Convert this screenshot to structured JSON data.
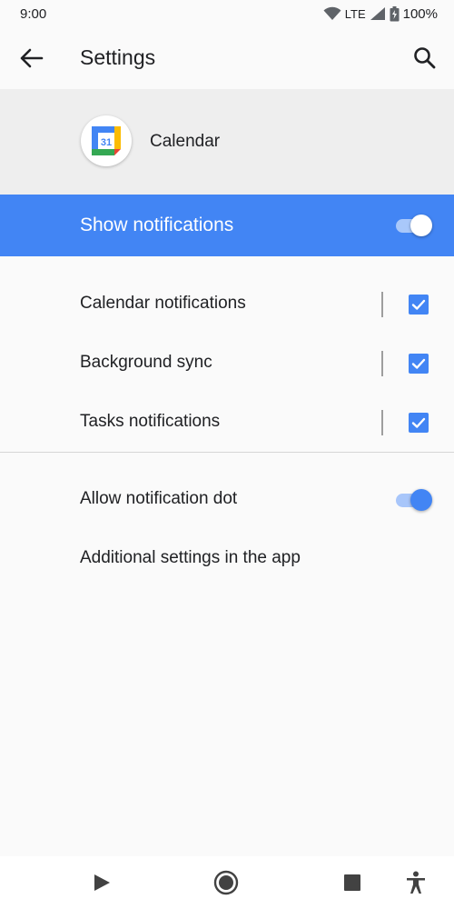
{
  "status_bar": {
    "time": "9:00",
    "network": "LTE",
    "battery": "100%",
    "icons": [
      "wifi-icon",
      "signal-icon",
      "battery-icon"
    ]
  },
  "app_bar": {
    "title": "Settings",
    "back_icon": "arrow-back-icon",
    "search_icon": "search-icon"
  },
  "app_header": {
    "app_name": "Calendar",
    "icon_day": "31"
  },
  "master_switch": {
    "label": "Show notifications",
    "on": true
  },
  "channels": [
    {
      "label": "Calendar notifications",
      "checked": true
    },
    {
      "label": "Background sync",
      "checked": true
    },
    {
      "label": "Tasks notifications",
      "checked": true
    }
  ],
  "more": {
    "notification_dot_label": "Allow notification dot",
    "notification_dot_on": true,
    "additional_label": "Additional settings in the app"
  },
  "nav_bar": {
    "icons": [
      "play-icon",
      "home-icon",
      "square-icon",
      "accessibility-icon"
    ]
  },
  "colors": {
    "accent": "#4285f4",
    "header_bg": "#eeeeee",
    "page_bg": "#fafafa"
  }
}
